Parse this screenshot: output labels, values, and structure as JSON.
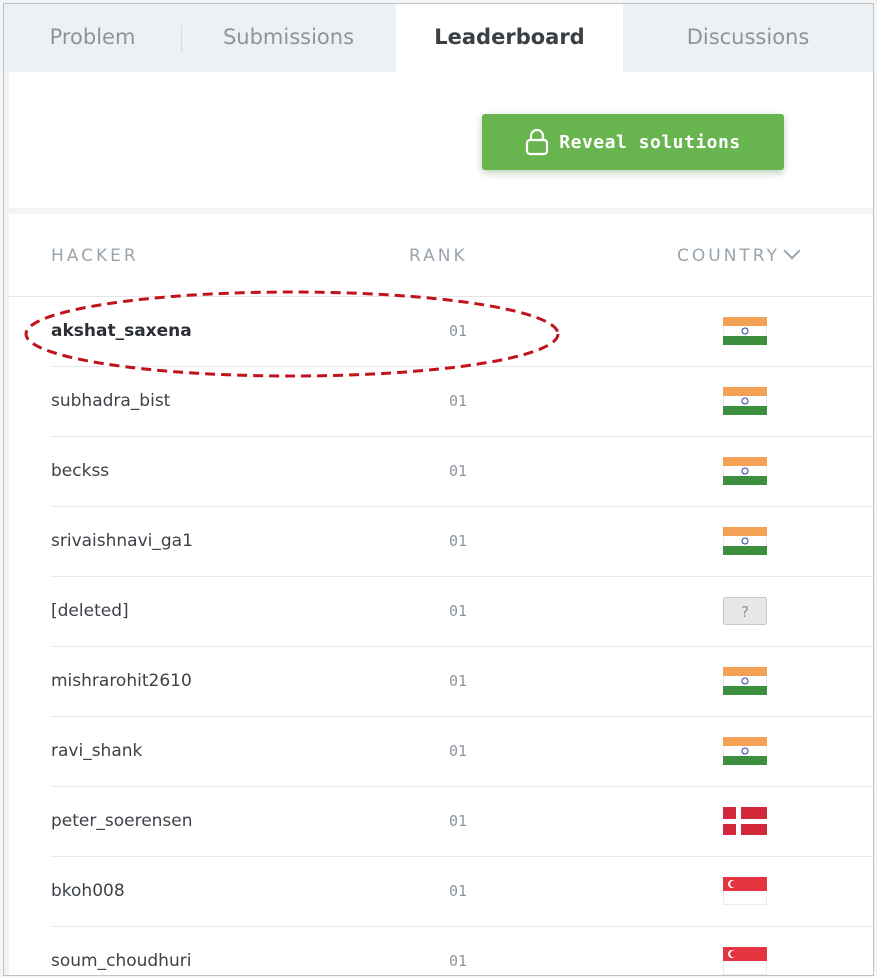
{
  "tabs": [
    {
      "label": "Problem",
      "active": false
    },
    {
      "label": "Submissions",
      "active": false
    },
    {
      "label": "Leaderboard",
      "active": true
    },
    {
      "label": "Discussions",
      "active": false
    }
  ],
  "toolbar": {
    "reveal_label": "Reveal solutions",
    "reveal_icon": "lock-icon",
    "button_color": "#68b54f"
  },
  "table": {
    "headers": {
      "hacker": "HACKER",
      "rank": "RANK",
      "country": "COUNTRY"
    },
    "rows": [
      {
        "hacker": "akshat_saxena",
        "rank": "01",
        "country_flag": "india-flag",
        "highlighted": true
      },
      {
        "hacker": "subhadra_bist",
        "rank": "01",
        "country_flag": "india-flag"
      },
      {
        "hacker": "beckss",
        "rank": "01",
        "country_flag": "india-flag"
      },
      {
        "hacker": "srivaishnavi_ga1",
        "rank": "01",
        "country_flag": "india-flag"
      },
      {
        "hacker": "[deleted]",
        "rank": "01",
        "country_flag": "unknown-flag",
        "unknown_glyph": "?"
      },
      {
        "hacker": "mishrarohit2610",
        "rank": "01",
        "country_flag": "india-flag"
      },
      {
        "hacker": "ravi_shank",
        "rank": "01",
        "country_flag": "india-flag"
      },
      {
        "hacker": "peter_soerensen",
        "rank": "01",
        "country_flag": "denmark-flag"
      },
      {
        "hacker": "bkoh008",
        "rank": "01",
        "country_flag": "singapore-flag"
      },
      {
        "hacker": "soum_choudhuri",
        "rank": "01",
        "country_flag": "singapore-flag"
      }
    ]
  },
  "annotation": {
    "color": "#c0141c",
    "style": "dashed-ellipse"
  }
}
